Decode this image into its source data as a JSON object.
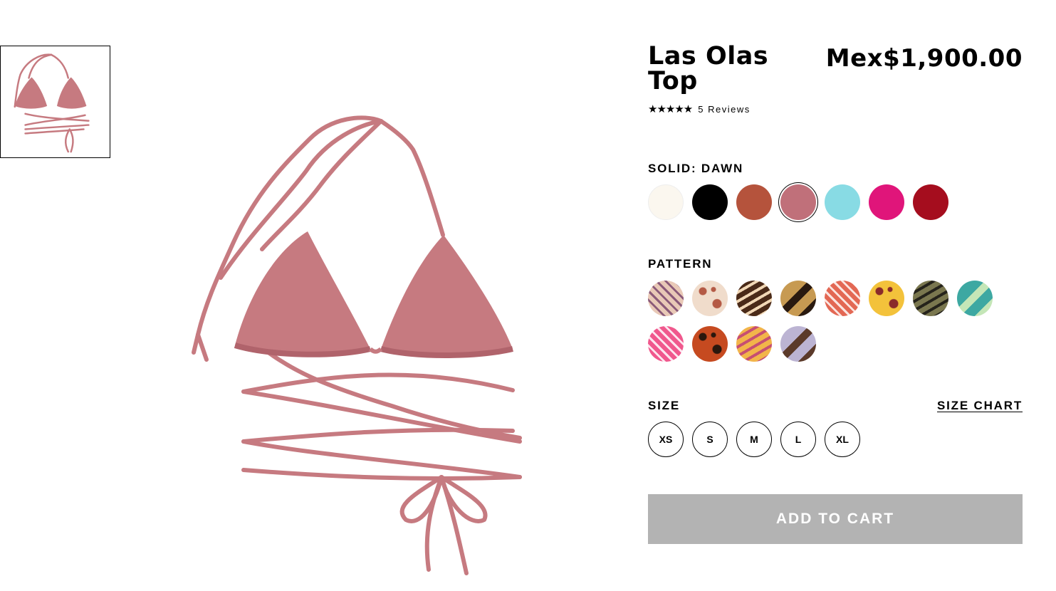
{
  "product": {
    "title": "Las Olas Top",
    "price": "Mex$1,900.00",
    "rating_stars": "★★★★★",
    "rating_value": 4.5,
    "reviews_label": "5 Reviews"
  },
  "solid": {
    "label": "SOLID: DAWN",
    "swatches": [
      {
        "name": "ivory",
        "color": "#fbf7ef"
      },
      {
        "name": "black",
        "color": "#000000"
      },
      {
        "name": "rust",
        "color": "#b5533c"
      },
      {
        "name": "dawn",
        "color": "#c0707a",
        "selected": true
      },
      {
        "name": "aqua",
        "color": "#88dbe4"
      },
      {
        "name": "fuchsia",
        "color": "#e0157a"
      },
      {
        "name": "red",
        "color": "#a50d1e"
      }
    ]
  },
  "pattern": {
    "label": "PATTERN",
    "swatches": [
      {
        "name": "pattern-swirl",
        "bg": "#e9c9b7",
        "fg": "#8b5a79"
      },
      {
        "name": "pattern-print-cream",
        "bg": "#f0dccb",
        "fg": "#b45a45"
      },
      {
        "name": "pattern-brown-geo",
        "bg": "#4a2a18",
        "fg": "#f1d7b5"
      },
      {
        "name": "pattern-leopard",
        "bg": "#c79a52",
        "fg": "#2a1a10"
      },
      {
        "name": "pattern-red-wave",
        "bg": "#e36854",
        "fg": "#fbe5e1"
      },
      {
        "name": "pattern-patchwork",
        "bg": "#f3c23b",
        "fg": "#8a2a2a"
      },
      {
        "name": "pattern-olive-stripe",
        "bg": "#7a774f",
        "fg": "#25231b"
      },
      {
        "name": "pattern-teal-wave",
        "bg": "#3da8a2",
        "fg": "#c4e6b7"
      },
      {
        "name": "pattern-pink-patch",
        "bg": "#f0588d",
        "fg": "#fde6ef"
      },
      {
        "name": "pattern-orange-geo",
        "bg": "#c64a20",
        "fg": "#2a170d"
      },
      {
        "name": "pattern-yellow-print",
        "bg": "#f2b54a",
        "fg": "#c64f72"
      },
      {
        "name": "pattern-lavender-patch",
        "bg": "#bcb4d3",
        "fg": "#5b3a2a"
      }
    ]
  },
  "size": {
    "label": "SIZE",
    "chart_label": "SIZE CHART",
    "options": [
      "XS",
      "S",
      "M",
      "L",
      "XL"
    ]
  },
  "cart": {
    "label": "ADD TO CART"
  },
  "colors": {
    "cart_bg": "#b3b3b3",
    "product": "#c0707a"
  }
}
